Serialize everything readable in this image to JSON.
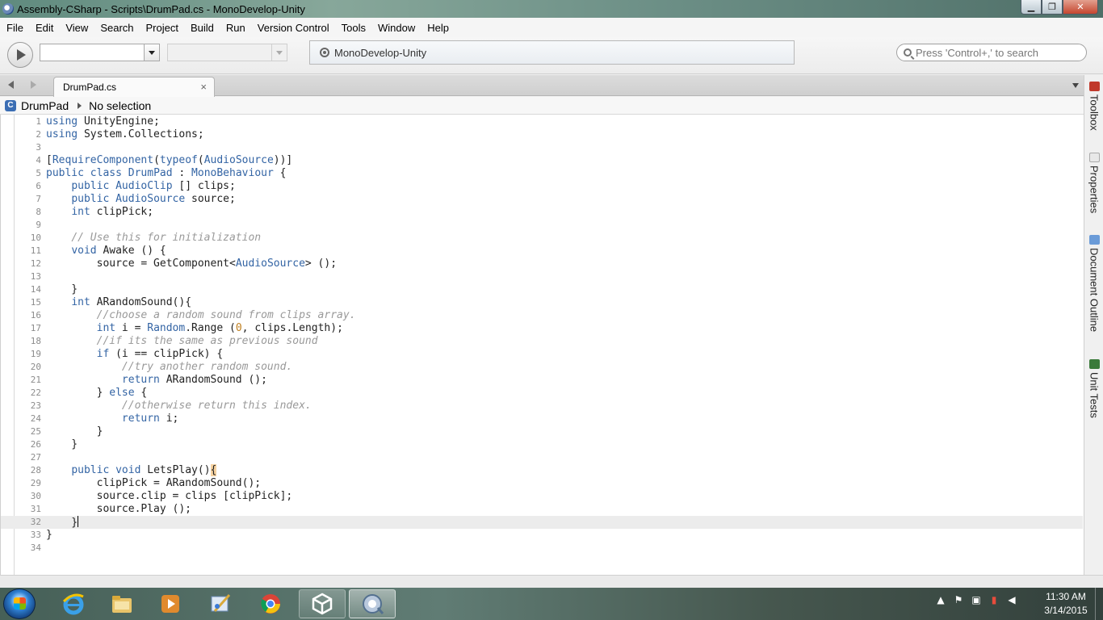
{
  "window": {
    "title": "Assembly-CSharp - Scripts\\DrumPad.cs - MonoDevelop-Unity"
  },
  "menu": [
    "File",
    "Edit",
    "View",
    "Search",
    "Project",
    "Build",
    "Run",
    "Version Control",
    "Tools",
    "Window",
    "Help"
  ],
  "toolbar": {
    "status_text": "MonoDevelop-Unity",
    "search_placeholder": "Press 'Control+,' to search"
  },
  "tabs": [
    {
      "label": "DrumPad.cs",
      "close": "×"
    }
  ],
  "breadcrumb": {
    "class_icon": "C",
    "class_name": "DrumPad",
    "selection": "No selection"
  },
  "dock": [
    {
      "label": "Toolbox",
      "icon": "toolbox-icon",
      "color": "#c0392b"
    },
    {
      "label": "Properties",
      "icon": "properties-icon",
      "color": "#cfcfcf"
    },
    {
      "label": "Document Outline",
      "icon": "document-outline-icon",
      "color": "#6a9bd8"
    },
    {
      "label": "Unit Tests",
      "icon": "unit-tests-icon",
      "color": "#3a7a3a"
    }
  ],
  "editor": {
    "current_line": 32,
    "lines": [
      "using UnityEngine;",
      "using System.Collections;",
      "",
      "[RequireComponent(typeof(AudioSource))]",
      "public class DrumPad : MonoBehaviour {",
      "    public AudioClip [] clips;",
      "    public AudioSource source;",
      "    int clipPick;",
      "",
      "    // Use this for initialization",
      "    void Awake () {",
      "        source = GetComponent<AudioSource> ();",
      "",
      "    }",
      "    int ARandomSound(){",
      "        //choose a random sound from clips array.",
      "        int i = Random.Range (0, clips.Length);",
      "        //if its the same as previous sound",
      "        if (i == clipPick) {",
      "            //try another random sound.",
      "            return ARandomSound ();",
      "        } else {",
      "            //otherwise return this index.",
      "            return i;",
      "        }",
      "    }",
      "",
      "    public void LetsPlay(){",
      "        clipPick = ARandomSound();",
      "        source.clip = clips [clipPick];",
      "        source.Play ();",
      "    }",
      "}",
      ""
    ]
  },
  "taskbar": {
    "apps": [
      "internet-explorer",
      "file-explorer",
      "media-player",
      "paint",
      "chrome",
      "unity",
      "monodevelop"
    ],
    "clock_time": "11:30 AM",
    "clock_date": "3/14/2015"
  },
  "colors": {
    "keyword": "#3364a4",
    "comment": "#999999",
    "number": "#c08020"
  }
}
